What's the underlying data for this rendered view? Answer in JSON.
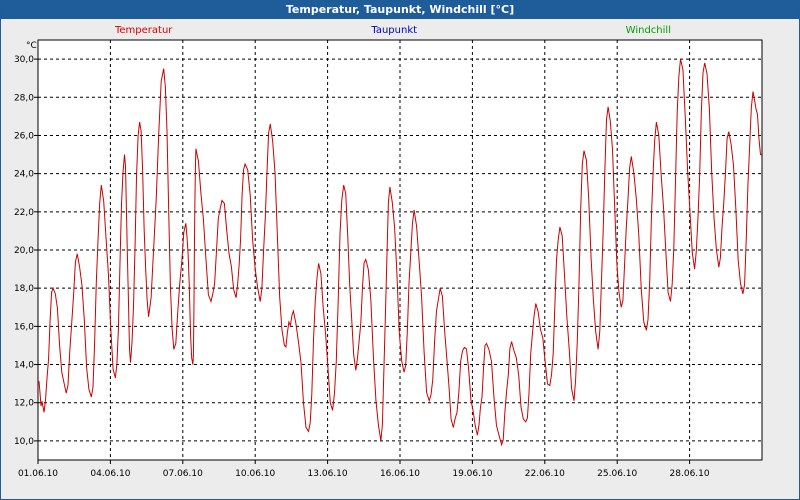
{
  "window": {
    "title": "Temperatur, Taupunkt, Windchill [°C]"
  },
  "chart_data": {
    "type": "line",
    "title": "Temperatur, Taupunkt, Windchill [°C]",
    "ylabel": "°C",
    "xlabel": "",
    "ylim": [
      9.0,
      31.0
    ],
    "xlim": [
      "01.06.10",
      "01.07.10"
    ],
    "x_ticks": [
      "01.06.10",
      "04.06.10",
      "07.06.10",
      "10.06.10",
      "13.06.10",
      "16.06.10",
      "19.06.10",
      "22.06.10",
      "25.06.10",
      "28.06.10"
    ],
    "y_ticks": [
      "10,0",
      "12,0",
      "14,0",
      "16,0",
      "18,0",
      "20,0",
      "22,0",
      "24,0",
      "26,0",
      "28,0",
      "30,0"
    ],
    "grid": true,
    "legend": [
      {
        "name": "Temperatur",
        "color": "#e00000"
      },
      {
        "name": "Taupunkt",
        "color": "#0000c0"
      },
      {
        "name": "Windchill",
        "color": "#00a000"
      }
    ],
    "series": [
      {
        "name": "Temperatur",
        "color": "#cc0000",
        "x": [
          "01.06.10 00:00",
          "01.06.10 06:00",
          "01.06.10 15:00",
          "02.06.10 04:00",
          "02.06.10 15:00",
          "03.06.10 05:00",
          "03.06.10 15:00",
          "04.06.10 05:00",
          "04.06.10 14:00",
          "04.06.10 20:00",
          "05.06.10 05:00",
          "05.06.10 14:00",
          "06.06.10 05:00",
          "06.06.10 15:00",
          "07.06.10 03:00",
          "07.06.10 10:00",
          "07.06.10 13:00",
          "08.06.10 04:00",
          "08.06.10 15:00",
          "09.06.10 05:00",
          "09.06.10 14:00",
          "10.06.10 05:00",
          "10.06.10 15:00",
          "11.06.10 05:00",
          "11.06.10 14:00",
          "12.06.10 05:00",
          "12.06.10 15:00",
          "13.06.10 05:00",
          "13.06.10 16:00",
          "14.06.10 04:00",
          "14.06.10 14:00",
          "15.06.10 05:00",
          "15.06.10 14:00",
          "16.06.10 04:00",
          "16.06.10 14:00",
          "17.06.10 05:00",
          "17.06.10 16:00",
          "18.06.10 05:00",
          "18.06.10 16:00",
          "19.06.10 05:00",
          "19.06.10 14:00",
          "20.06.10 05:00",
          "20.06.10 15:00",
          "21.06.10 05:00",
          "21.06.10 15:00",
          "22.06.10 05:00",
          "22.06.10 15:00",
          "23.06.10 05:00",
          "23.06.10 15:00",
          "24.06.10 05:00",
          "24.06.10 15:00",
          "25.06.10 04:00",
          "25.06.10 14:00",
          "26.06.10 05:00",
          "26.06.10 15:00",
          "27.06.10 05:00",
          "27.06.10 15:00",
          "28.06.10 05:00",
          "28.06.10 15:00",
          "29.06.10 05:00",
          "29.06.10 15:00",
          "30.06.10 05:00",
          "30.06.10 15:00",
          "01.07.10 00:00"
        ],
        "values": [
          13.0,
          11.5,
          18.0,
          12.5,
          19.8,
          12.3,
          23.4,
          13.3,
          25.0,
          14.1,
          26.7,
          16.5,
          29.5,
          14.8,
          21.4,
          14.0,
          25.3,
          17.3,
          22.6,
          17.5,
          24.5,
          17.3,
          26.6,
          15.0,
          16.8,
          10.5,
          19.3,
          11.6,
          23.4,
          13.7,
          19.5,
          10.0,
          23.3,
          13.6,
          22.1,
          12.1,
          18.0,
          10.7,
          14.9,
          10.3,
          15.1,
          9.8,
          15.2,
          11.0,
          17.2,
          12.9,
          21.2,
          12.1,
          25.2,
          14.8,
          27.5,
          17.0,
          24.9,
          15.8,
          26.7,
          17.3,
          30.0,
          19.0,
          29.8,
          19.1,
          26.2,
          17.7,
          28.3,
          25.0
        ]
      },
      {
        "name": "Taupunkt",
        "color": "#0000c0",
        "x": [],
        "values": []
      },
      {
        "name": "Windchill",
        "color": "#00a000",
        "x": [],
        "values": []
      }
    ]
  }
}
